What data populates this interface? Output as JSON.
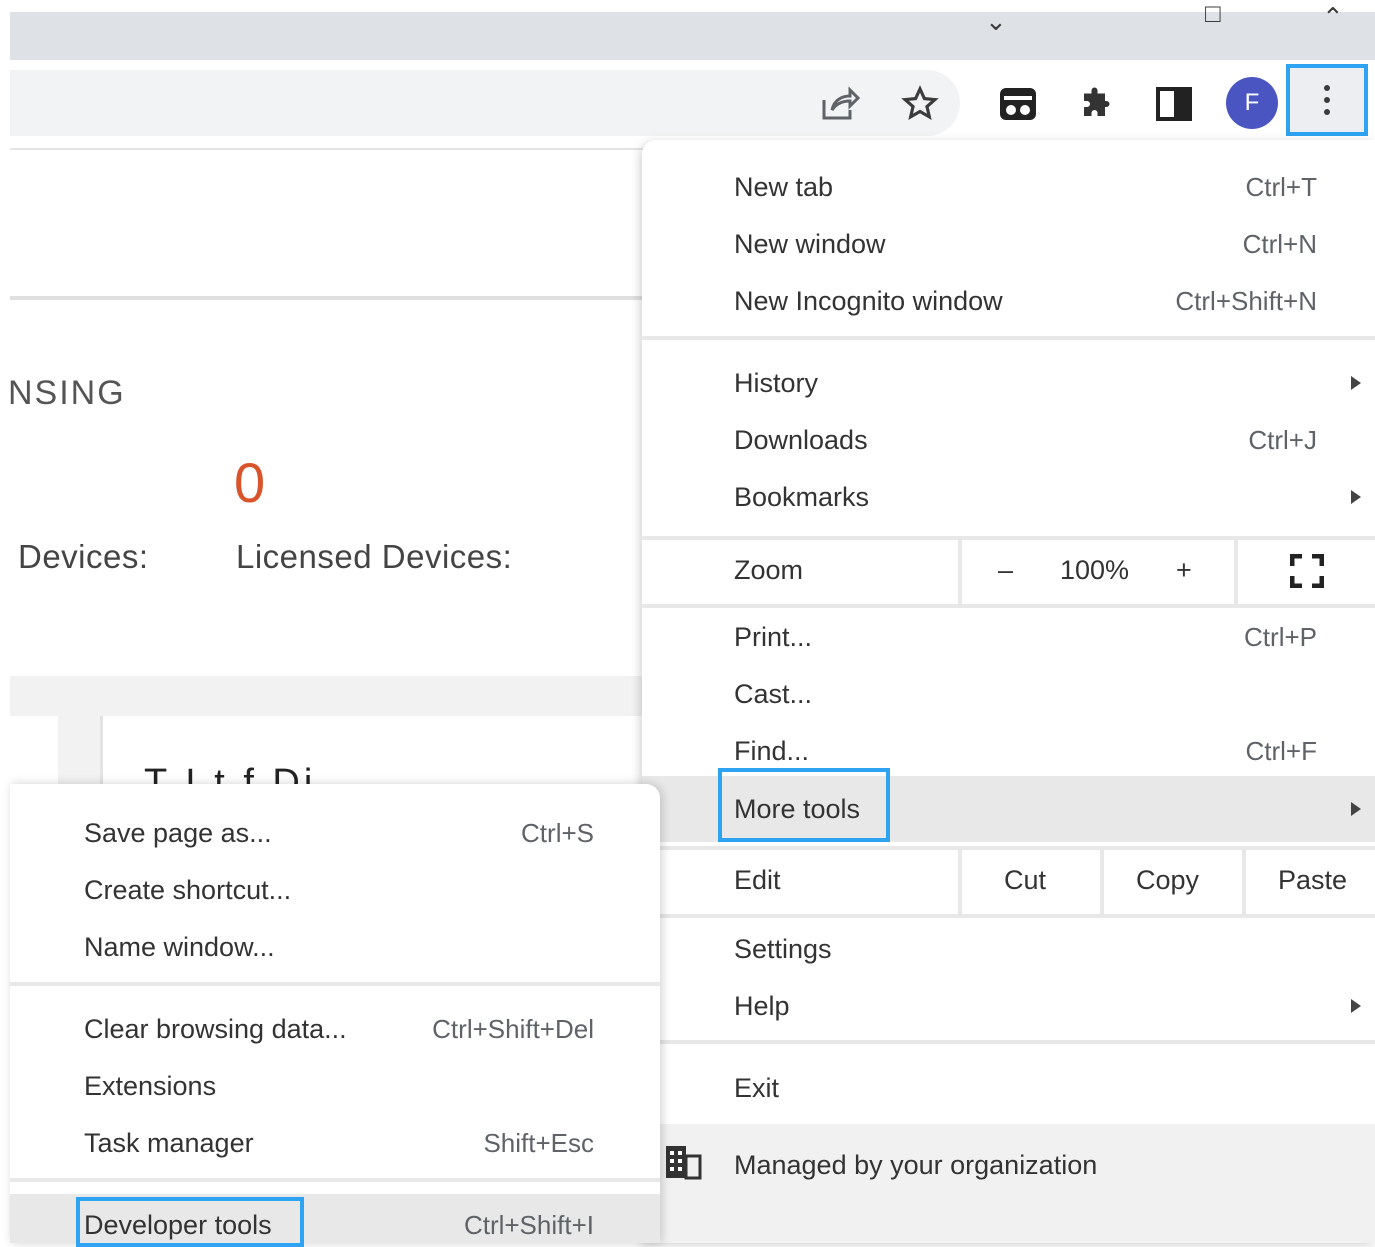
{
  "toolbar": {
    "avatar_letter": "F"
  },
  "page": {
    "partial_heading": "NSING",
    "count_value": "0",
    "label_devices": "Devices:",
    "label_licensed_devices": "Licensed Devices:",
    "cut_heading": "T          I   t    f    Di"
  },
  "menu": {
    "new_tab": {
      "label": "New tab",
      "shortcut": "Ctrl+T"
    },
    "new_window": {
      "label": "New window",
      "shortcut": "Ctrl+N"
    },
    "new_incognito": {
      "label": "New Incognito window",
      "shortcut": "Ctrl+Shift+N"
    },
    "history": {
      "label": "History"
    },
    "downloads": {
      "label": "Downloads",
      "shortcut": "Ctrl+J"
    },
    "bookmarks": {
      "label": "Bookmarks"
    },
    "zoom": {
      "label": "Zoom",
      "minus": "–",
      "value": "100%",
      "plus": "+"
    },
    "print": {
      "label": "Print...",
      "shortcut": "Ctrl+P"
    },
    "cast": {
      "label": "Cast..."
    },
    "find": {
      "label": "Find...",
      "shortcut": "Ctrl+F"
    },
    "more_tools": {
      "label": "More tools"
    },
    "edit": {
      "label": "Edit",
      "cut": "Cut",
      "copy": "Copy",
      "paste": "Paste"
    },
    "settings": {
      "label": "Settings"
    },
    "help": {
      "label": "Help"
    },
    "exit": {
      "label": "Exit"
    },
    "managed": {
      "label": "Managed by your organization"
    }
  },
  "submenu": {
    "save_page": {
      "label": "Save page as...",
      "shortcut": "Ctrl+S"
    },
    "create_shortcut": {
      "label": "Create shortcut..."
    },
    "name_window": {
      "label": "Name window..."
    },
    "clear_data": {
      "label": "Clear browsing data...",
      "shortcut": "Ctrl+Shift+Del"
    },
    "extensions": {
      "label": "Extensions"
    },
    "task_manager": {
      "label": "Task manager",
      "shortcut": "Shift+Esc"
    },
    "developer_tools": {
      "label": "Developer tools",
      "shortcut": "Ctrl+Shift+I"
    }
  },
  "colors": {
    "highlight_border": "#2ea3f2",
    "avatar_bg": "#4a55c2",
    "count_color": "#d9532b"
  }
}
